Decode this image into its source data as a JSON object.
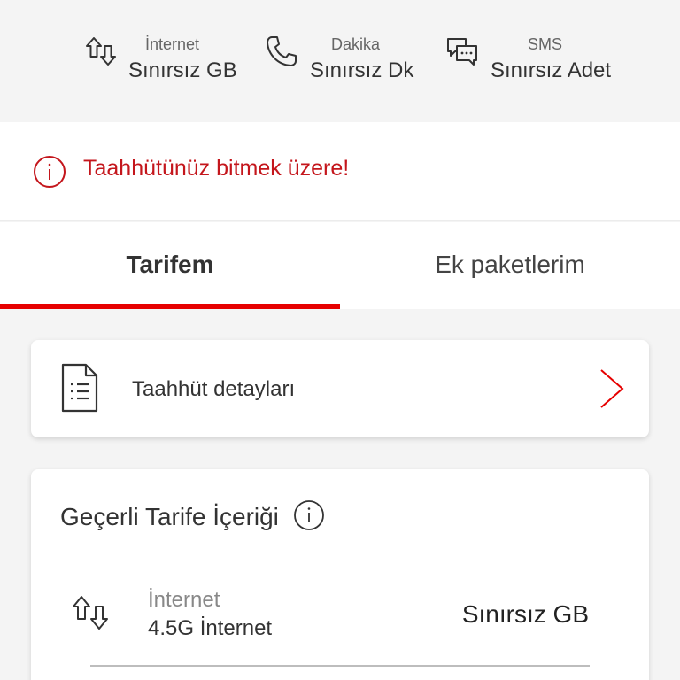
{
  "summary": [
    {
      "label": "İnternet",
      "value": "Sınırsız GB",
      "icon": "data-transfer-icon"
    },
    {
      "label": "Dakika",
      "value": "Sınırsız Dk",
      "icon": "phone-icon"
    },
    {
      "label": "SMS",
      "value": "Sınırsız Adet",
      "icon": "chat-bubbles-icon"
    }
  ],
  "alert": {
    "text": "Taahhütünüz bitmek üzere!",
    "icon": "info-icon",
    "color": "#c4161c"
  },
  "tabs": [
    {
      "label": "Tarifem",
      "active": true
    },
    {
      "label": "Ek paketlerim",
      "active": false
    }
  ],
  "commitment_card": {
    "label": "Taahhüt detayları",
    "icon": "document-icon",
    "chevron": "chevron-right-icon"
  },
  "tariff_card": {
    "title": "Geçerli Tarife İçeriği",
    "info_icon": "info-icon",
    "item": {
      "label": "İnternet",
      "sublabel": "4.5G İnternet",
      "value": "Sınırsız GB",
      "icon": "data-transfer-icon"
    }
  },
  "colors": {
    "accent": "#e60000",
    "alert": "#c4161c",
    "background": "#f4f4f4"
  }
}
